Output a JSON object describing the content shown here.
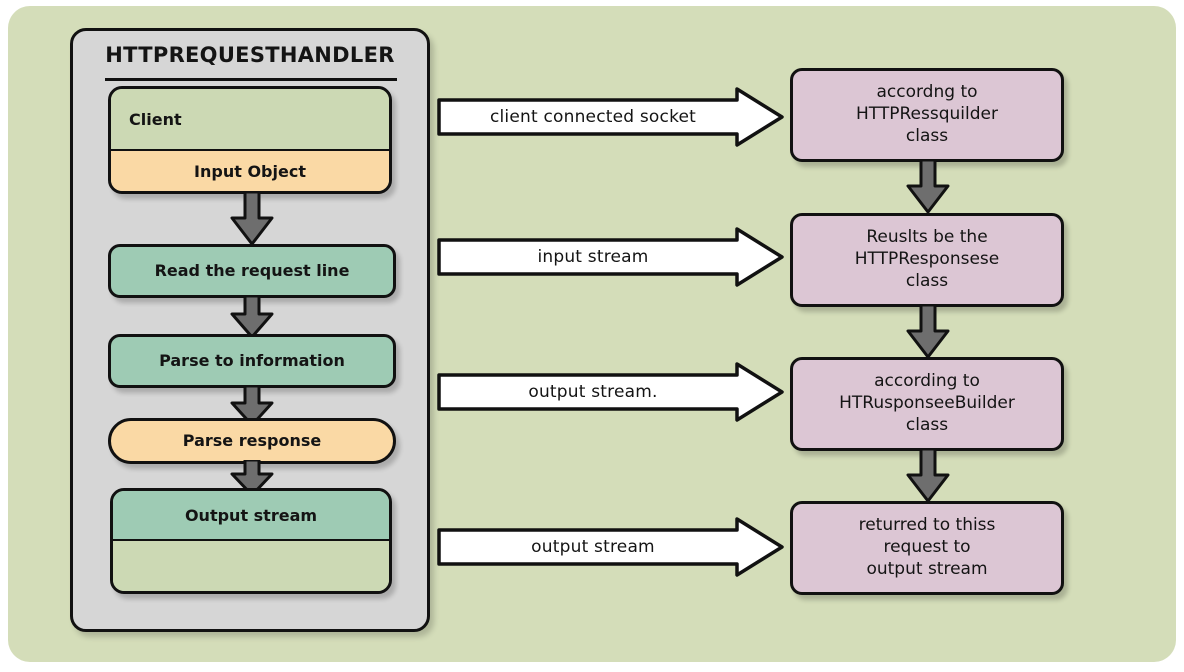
{
  "diagram": {
    "title": "HTTPREQUESTHANDLER",
    "background_color": "#d4ddb9",
    "panel_color": "#d6d6d6",
    "green_color": "#9ecbb4",
    "orange_color": "#fad9a5",
    "pink_color": "#dcc6d4",
    "sage_color": "#ccd9b4",
    "outline_color": "#111111",
    "arrow_fill_color": "#6e6e6e"
  },
  "left_column": {
    "client_box": {
      "top_label": "Client",
      "bottom_label": "Input Object"
    },
    "steps": [
      {
        "label": "Read the request line",
        "style": "green"
      },
      {
        "label": "Parse to information",
        "style": "green"
      },
      {
        "label": "Parse response",
        "style": "orange"
      }
    ],
    "output_box": {
      "top_label": "Output stream",
      "bottom_label": ""
    }
  },
  "connectors": [
    {
      "label": "client connected socket"
    },
    {
      "label": "input stream"
    },
    {
      "label": "output stream."
    },
    {
      "label": "output stream"
    }
  ],
  "right_column": {
    "boxes": [
      {
        "lines": [
          "accordng to",
          "HTTPRessquilder",
          "class"
        ]
      },
      {
        "lines": [
          "Reuslts be the",
          "HTTPResponsese",
          "class"
        ]
      },
      {
        "lines": [
          "according to",
          "HTRusponseeBuilder",
          "class"
        ]
      },
      {
        "lines": [
          "returred to thiss",
          "request to",
          "output stream"
        ]
      }
    ]
  }
}
